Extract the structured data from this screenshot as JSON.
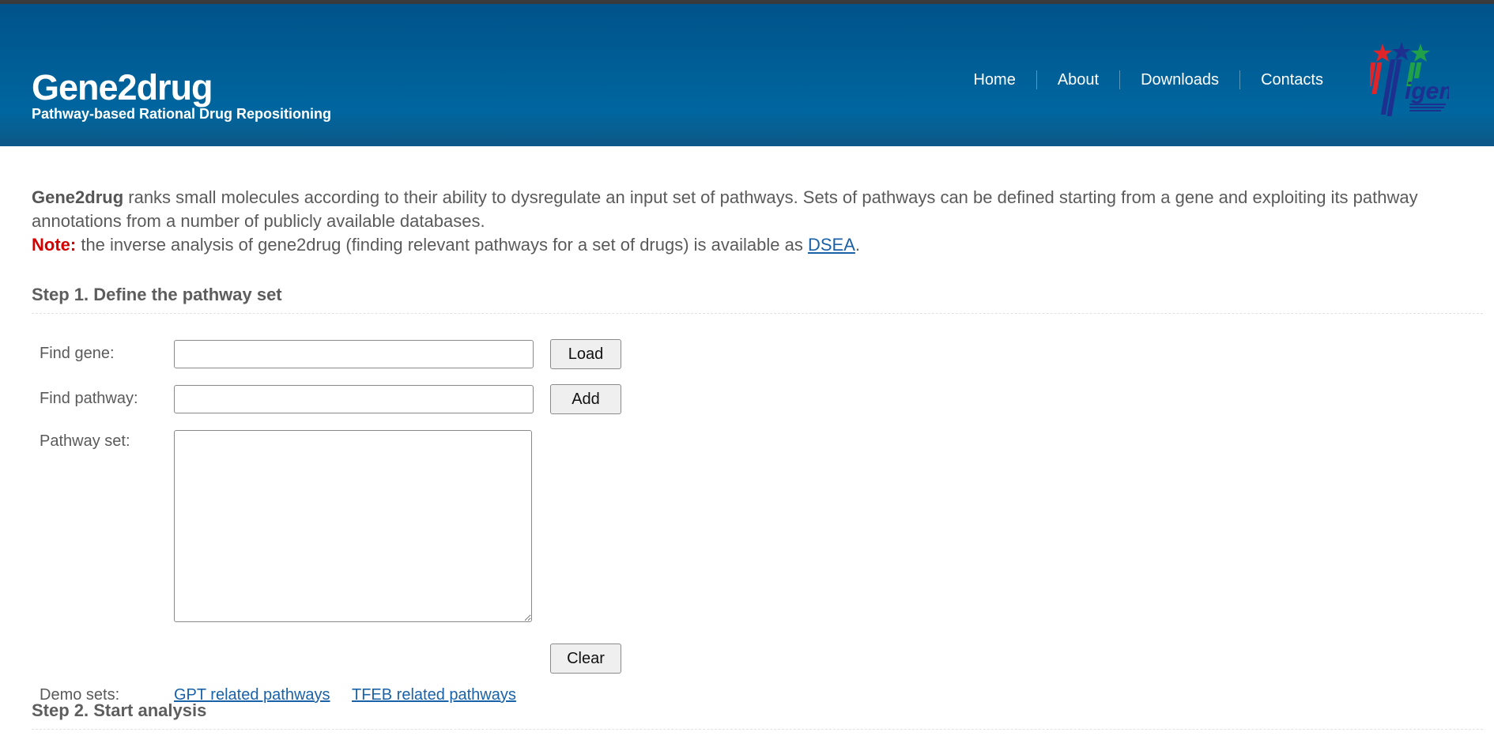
{
  "header": {
    "title": "Gene2drug",
    "subtitle": "Pathway-based Rational Drug Repositioning",
    "nav": [
      {
        "label": "Home"
      },
      {
        "label": "About"
      },
      {
        "label": "Downloads"
      },
      {
        "label": "Contacts"
      }
    ],
    "logo": {
      "text": "igem",
      "icon": "tigem-logo-icon",
      "star_colors": [
        "#e0252a",
        "#1d2f8f",
        "#21a04a"
      ]
    }
  },
  "intro": {
    "app_name": "Gene2drug",
    "description": " ranks small molecules according to their ability to dysregulate an input set of pathways. Sets of pathways can be defined starting from a gene and exploiting its pathway annotations from a number of publicly available databases.",
    "note_label": "Note:",
    "note_text": " the inverse analysis of gene2drug (finding relevant pathways for a set of drugs) is available as ",
    "note_link": "DSEA",
    "note_end": "."
  },
  "step1": {
    "heading": "Step 1. Define the pathway set",
    "find_gene": {
      "label": "Find gene:",
      "value": "",
      "button": "Load"
    },
    "find_pathway": {
      "label": "Find pathway:",
      "value": "",
      "button": "Add"
    },
    "pathway_set": {
      "label": "Pathway set:",
      "value": "",
      "button": "Clear"
    },
    "demo_sets": {
      "label": "Demo sets:",
      "links": [
        {
          "label": "GPT related pathways"
        },
        {
          "label": "TFEB related pathways"
        }
      ]
    }
  },
  "step2": {
    "heading": "Step 2. Start analysis"
  },
  "colors": {
    "header_bg": "#00538a",
    "note_red": "#d40000",
    "link_blue": "#1a62a8"
  }
}
